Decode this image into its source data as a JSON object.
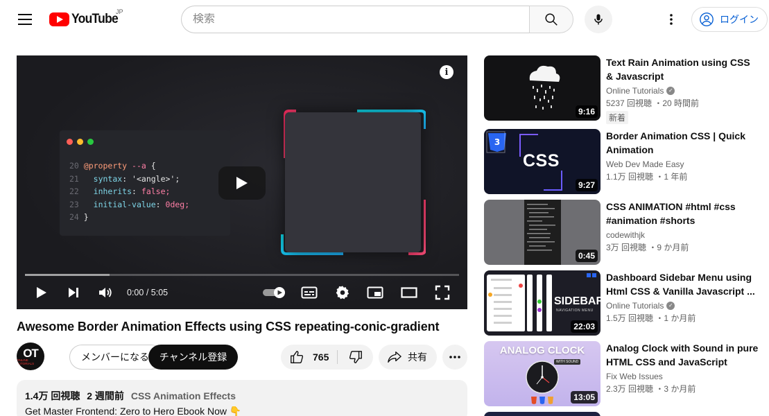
{
  "masthead": {
    "logo_text": "YouTube",
    "region": "JP",
    "search_placeholder": "検索",
    "signin_label": "ログイン"
  },
  "player": {
    "time_current": "0:00",
    "time_separator": "/",
    "time_total": "5:05",
    "progress_loaded": 0.195,
    "code_lines": [
      {
        "n": "20",
        "text": "@property --a {"
      },
      {
        "n": "21",
        "text": "  syntax: '<angle>';"
      },
      {
        "n": "22",
        "text": "  inherits: false;"
      },
      {
        "n": "23",
        "text": "  initial-value: 0deg;"
      },
      {
        "n": "24",
        "text": "}"
      }
    ]
  },
  "video": {
    "title": "Awesome Border Animation Effects using CSS repeating-conic-gradient",
    "channel_avatar_text": "OT",
    "channel_avatar_sub": "ONLINE TUTORIALS",
    "member_label": "メンバーになる",
    "subscribe_label": "チャンネル登録",
    "like_count": "765",
    "share_label": "共有"
  },
  "description": {
    "views": "1.4万 回視聴",
    "age": "2 週間前",
    "tag": "CSS Animation Effects",
    "line1": "Get Master Frontend: Zero to Hero Ebook Now 👇"
  },
  "related": [
    {
      "title": "Text Rain Animation using CSS & Javascript",
      "channel": "Online Tutorials",
      "verified": true,
      "views": "5237 回視聴",
      "age": "20 時間前",
      "badge": "新着",
      "duration": "9:16"
    },
    {
      "title": "Border Animation CSS | Quick Animation",
      "channel": "Web Dev Made Easy",
      "verified": false,
      "views": "1.1万 回視聴",
      "age": "1 年前",
      "duration": "9:27",
      "thumb_text": "CSS"
    },
    {
      "title": "CSS ANIMATION #html #css #animation #shorts",
      "channel": "codewithjk",
      "verified": false,
      "views": "3万 回視聴",
      "age": "9 か月前",
      "duration": "0:45"
    },
    {
      "title": "Dashboard Sidebar Menu using Html CSS & Vanilla Javascript ...",
      "channel": "Online Tutorials",
      "verified": true,
      "views": "1.5万 回視聴",
      "age": "1 か月前",
      "duration": "22:03",
      "thumb_text": "SIDEBAR",
      "thumb_sub": "NAVIGATION MENU"
    },
    {
      "title": "Analog Clock with Sound in pure HTML CSS and JavaScript",
      "channel": "Fix Web Issues",
      "verified": false,
      "views": "2.3万 回視聴",
      "age": "3 か月前",
      "duration": "13:05",
      "thumb_text": "ANALOG CLOCK",
      "thumb_sub": "WITH SOUND"
    }
  ]
}
